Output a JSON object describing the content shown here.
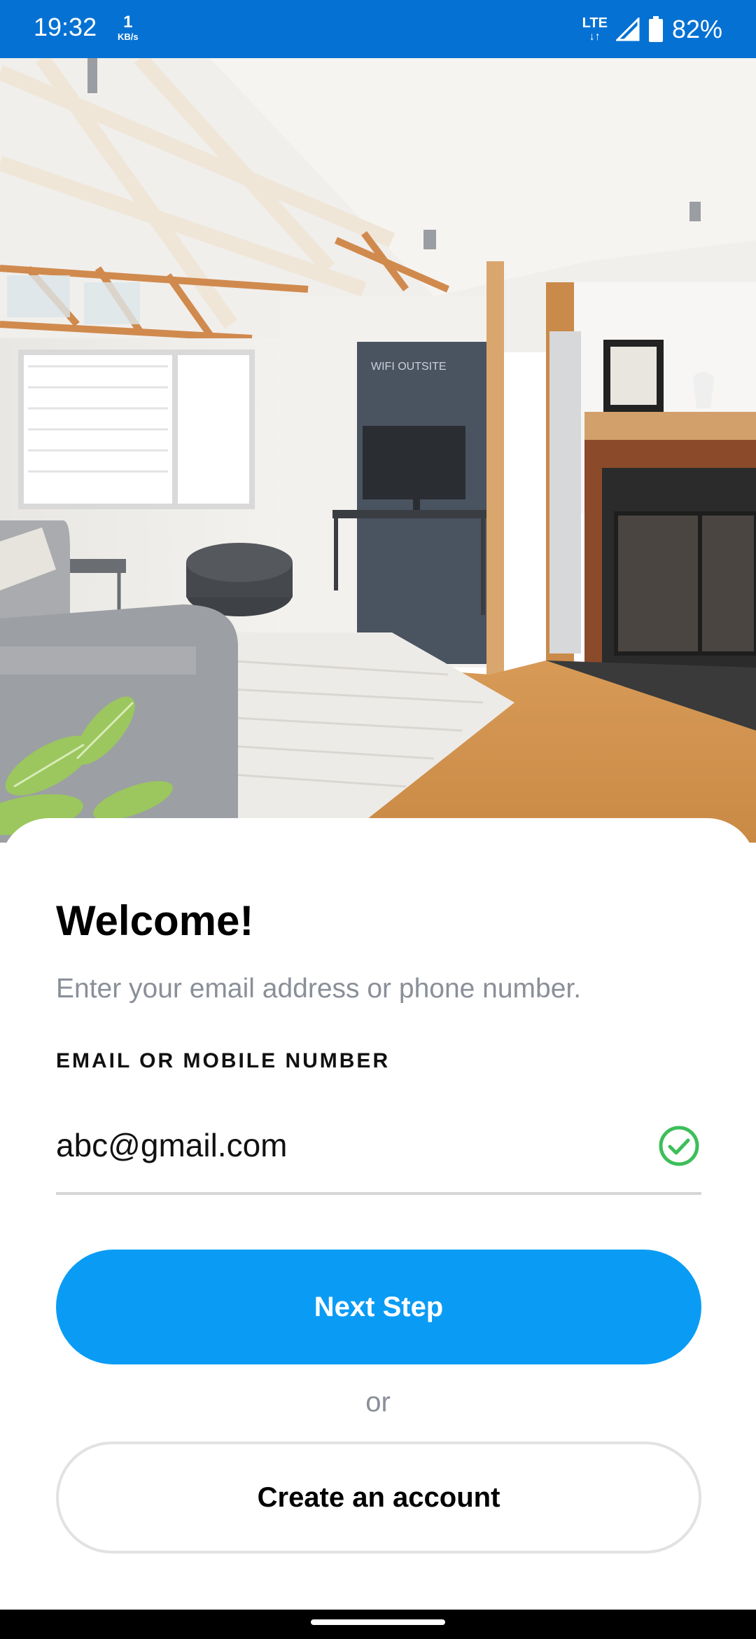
{
  "status_bar": {
    "time": "19:32",
    "net_speed_value": "1",
    "net_speed_unit": "KB/s",
    "network_type": "LTE",
    "battery_percent": "82%",
    "icons": [
      "lte-icon",
      "signal-icon",
      "battery-icon"
    ]
  },
  "hero": {
    "description_icon": "room-photo",
    "sign_text": "WIFI OUTSITE"
  },
  "login": {
    "title": "Welcome!",
    "subtitle": "Enter your email address or phone number.",
    "field_label": "EMAIL OR MOBILE NUMBER",
    "field_value": "abc@gmail.com",
    "field_valid": true,
    "valid_icon": "check-circle-icon",
    "next_button": "Next Step",
    "or_text": "or",
    "create_button": "Create an account"
  },
  "colors": {
    "status_bar": "#0571D3",
    "primary_button": "#0A9CF5",
    "valid_check": "#3DBE5A",
    "muted_text": "#8A8F98"
  }
}
